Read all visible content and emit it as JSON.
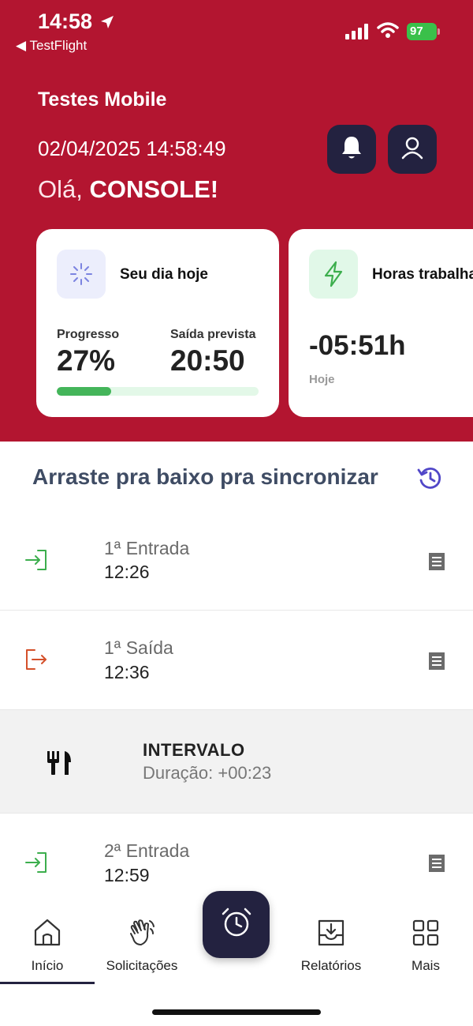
{
  "status_bar": {
    "time": "14:58",
    "back_app": "◀ TestFlight",
    "battery": "97"
  },
  "header": {
    "app_title": "Testes Mobile",
    "datetime": "02/04/2025 14:58:49",
    "greeting_prefix": "Olá, ",
    "greeting_name": "CONSOLE!"
  },
  "cards": {
    "day": {
      "title": "Seu dia hoje",
      "progress_label": "Progresso",
      "progress_value": "27%",
      "progress_fraction": 0.27,
      "exit_label": "Saída prevista",
      "exit_value": "20:50"
    },
    "hours": {
      "title": "Horas trabalhadas",
      "value": "-05:51h",
      "sub_label": "Hoje"
    }
  },
  "sync": {
    "text": "Arraste pra baixo pra sincronizar"
  },
  "entries": [
    {
      "label": "1ª Entrada",
      "time": "12:26",
      "kind": "entry"
    },
    {
      "label": "1ª Saída",
      "time": "12:36",
      "kind": "exit"
    },
    {
      "label": "2ª Entrada",
      "time": "12:59",
      "kind": "entry"
    }
  ],
  "break": {
    "title": "INTERVALO",
    "duration": "Duração: +00:23"
  },
  "nav": {
    "inicio": "Início",
    "solicitacoes": "Solicitações",
    "relatorios": "Relatórios",
    "mais": "Mais"
  },
  "colors": {
    "brand_red": "#b31530",
    "navy": "#232240",
    "progress_green": "#44b55a",
    "entry_green": "#3cae4d",
    "exit_orange": "#d4502a"
  }
}
